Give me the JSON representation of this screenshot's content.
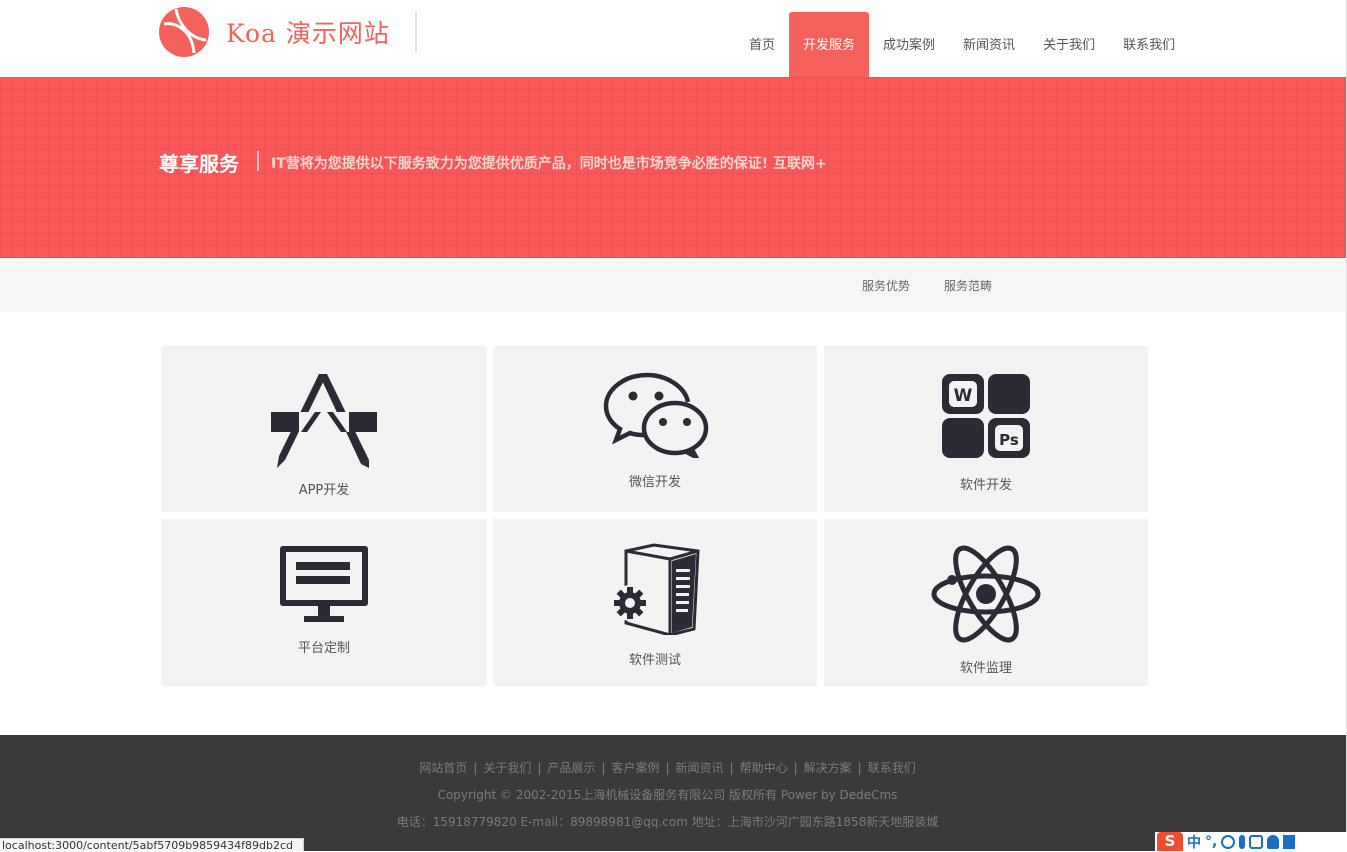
{
  "header": {
    "logo_text": "Koa 演示网站",
    "nav": [
      {
        "label": "首页",
        "active": false
      },
      {
        "label": "开发服务",
        "active": true
      },
      {
        "label": "成功案例",
        "active": false
      },
      {
        "label": "新闻资讯",
        "active": false
      },
      {
        "label": "关于我们",
        "active": false
      },
      {
        "label": "联系我们",
        "active": false
      }
    ]
  },
  "banner": {
    "title": "尊享服务",
    "description": "IT营将为您提供以下服务致力为您提供优质产品，同时也是市场竞争必胜的保证! 互联网+"
  },
  "subnav": {
    "items": [
      "服务优势",
      "服务范畴"
    ]
  },
  "services": [
    {
      "label": "APP开发",
      "icon": "app-store-icon"
    },
    {
      "label": "微信开发",
      "icon": "wechat-icon"
    },
    {
      "label": "软件开发",
      "icon": "office-apps-icon"
    },
    {
      "label": "平台定制",
      "icon": "monitor-icon"
    },
    {
      "label": "软件测试",
      "icon": "server-gear-icon"
    },
    {
      "label": "软件监理",
      "icon": "atom-icon"
    }
  ],
  "footer": {
    "links": [
      "网站首页",
      "关于我们",
      "产品展示",
      "客户案例",
      "新闻资讯",
      "帮助中心",
      "解决方案",
      "联系我们"
    ],
    "copyright": "Copyright © 2002-2015上海机械设备服务有限公司 版权所有 Power by DedeCms",
    "contact": "电话：15918779820 E-mail：89898981@qq.com 地址：上海市沙河广园东路1858新天地服装城"
  },
  "status_bar": {
    "url": "localhost:3000/content/5abf5709b9859434f89db2cd"
  },
  "ime": {
    "label": "中"
  },
  "colors": {
    "brand": "#f4625b",
    "banner": "#f9575a",
    "footer": "#3a3a3a",
    "card": "#f3f3f4"
  }
}
